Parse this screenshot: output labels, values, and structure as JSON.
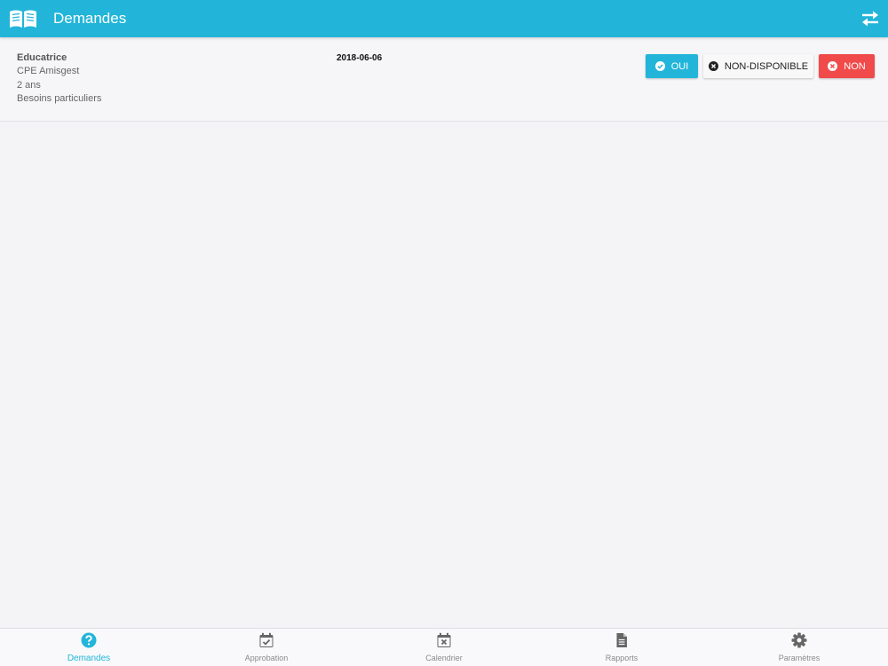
{
  "header": {
    "title": "Demandes",
    "logo_icon": "open-book-icon",
    "swap_icon": "swap-arrows-icon"
  },
  "request": {
    "title": "Educatrice",
    "organization": "CPE Amisgest",
    "age": "2 ans",
    "needs": "Besoins particuliers",
    "date": "2018-06-06",
    "actions": {
      "oui_label": "OUI",
      "non_disponible_label": "NON-DISPONIBLE",
      "non_label": "NON"
    }
  },
  "tabs": [
    {
      "label": "Demandes",
      "icon": "question-circle-icon",
      "active": true
    },
    {
      "label": "Approbation",
      "icon": "calendar-check-icon",
      "active": false
    },
    {
      "label": "Calendrier",
      "icon": "calendar-x-icon",
      "active": false
    },
    {
      "label": "Rapports",
      "icon": "document-icon",
      "active": false
    },
    {
      "label": "Paramètres",
      "icon": "gear-icon",
      "active": false
    }
  ],
  "colors": {
    "primary": "#22b5d9",
    "danger": "#f04a4a",
    "background": "#f4f4f7",
    "inactive_tab": "#8a8a8a"
  }
}
